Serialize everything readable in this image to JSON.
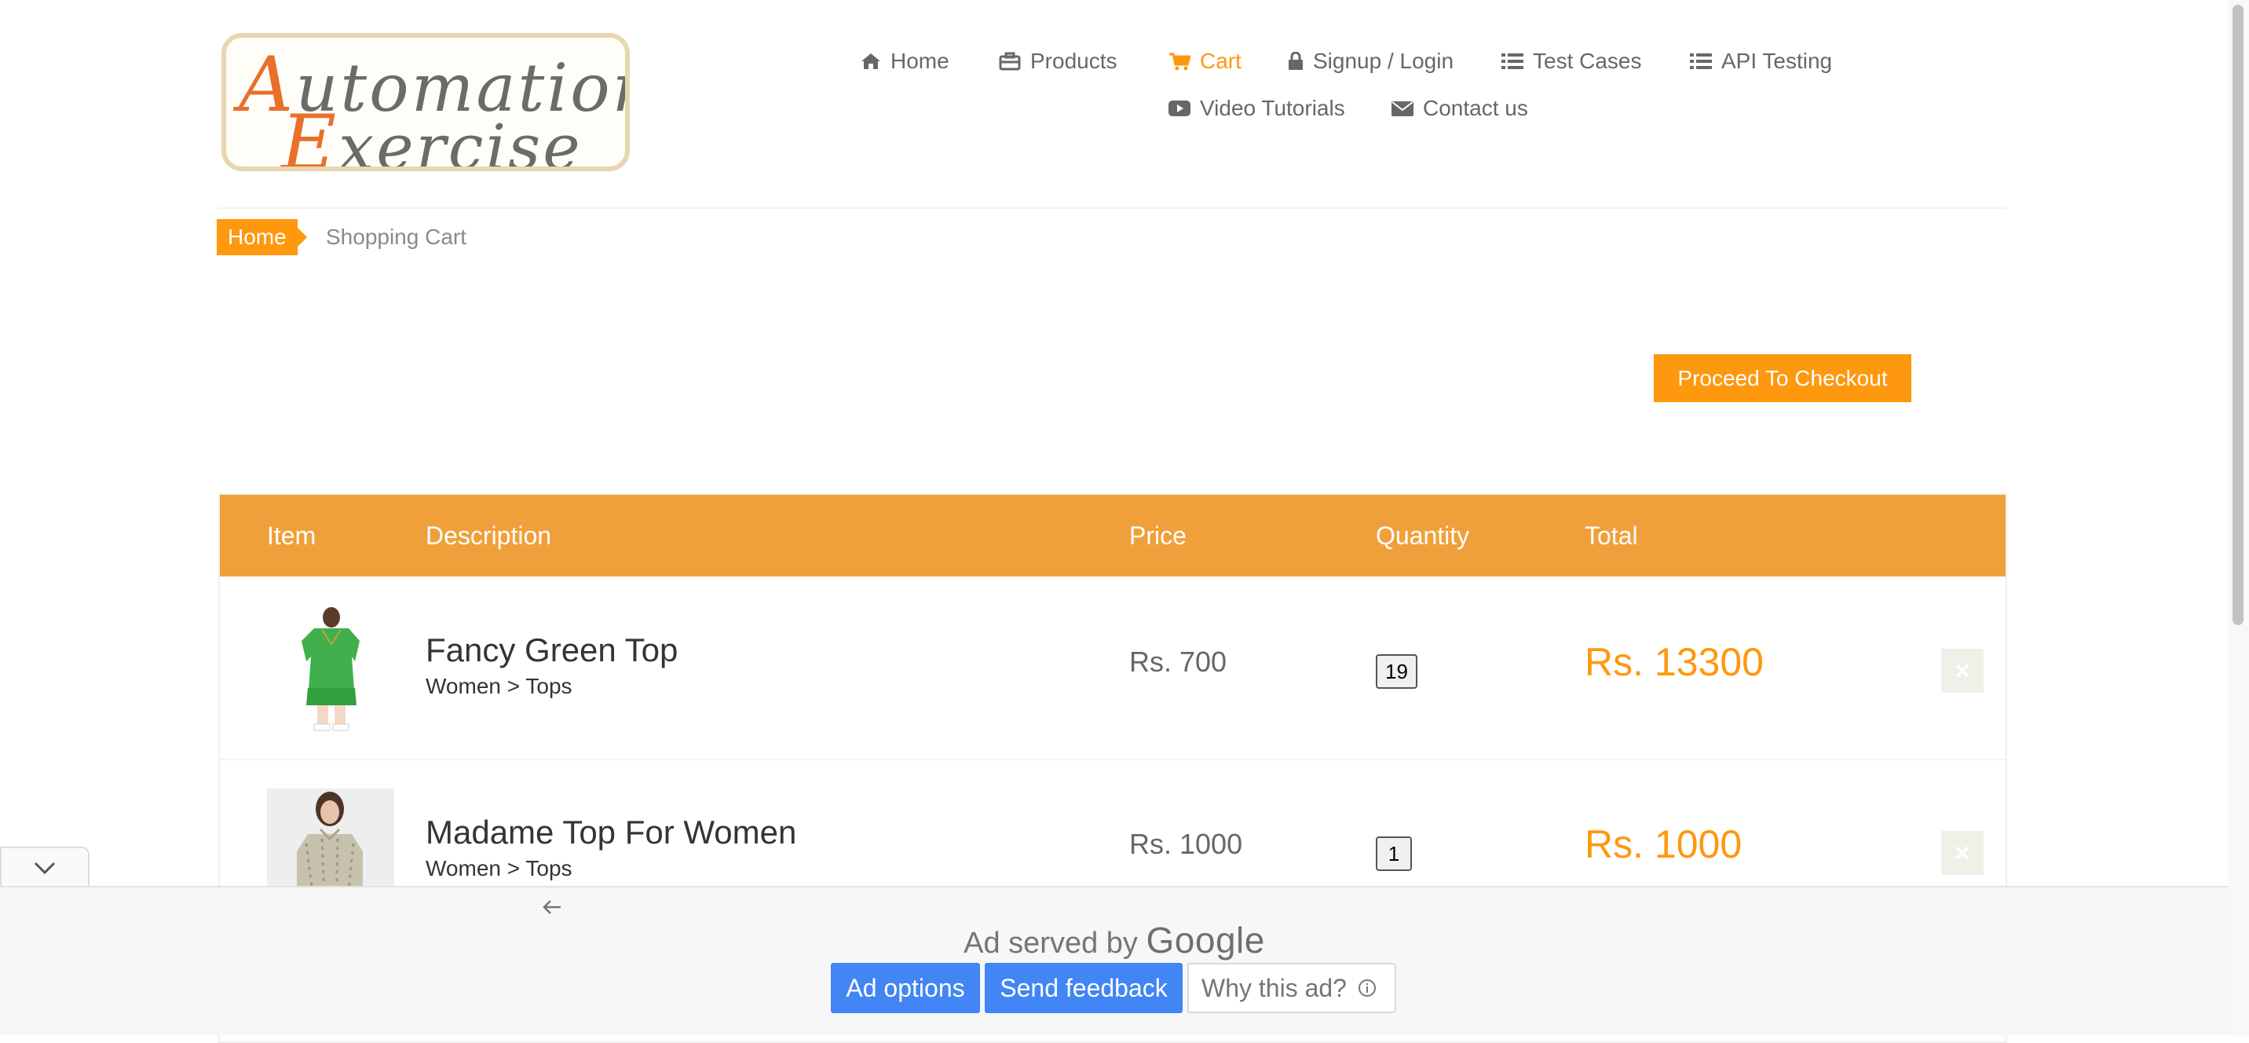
{
  "logo": {
    "line1_cap": "A",
    "line1_rest": "utomation",
    "line2_cap": "E",
    "line2_rest": "xercise"
  },
  "nav": {
    "items": [
      {
        "label": "Home",
        "icon": "home-icon"
      },
      {
        "label": "Products",
        "icon": "briefcase-icon"
      },
      {
        "label": "Cart",
        "icon": "shopping-cart-icon",
        "active": true
      },
      {
        "label": "Signup / Login",
        "icon": "lock-icon"
      },
      {
        "label": "Test Cases",
        "icon": "list-icon"
      },
      {
        "label": "API Testing",
        "icon": "list-icon"
      },
      {
        "label": "Video Tutorials",
        "icon": "youtube-play-icon"
      },
      {
        "label": "Contact us",
        "icon": "envelope-icon"
      }
    ]
  },
  "breadcrumb": {
    "home": "Home",
    "current": "Shopping Cart"
  },
  "checkout_button": "Proceed To Checkout",
  "cart": {
    "headers": [
      "Item",
      "Description",
      "Price",
      "Quantity",
      "Total"
    ],
    "rows": [
      {
        "name": "Fancy Green Top",
        "category": "Women > Tops",
        "price": "Rs. 700",
        "quantity": "19",
        "total": "Rs. 13300"
      },
      {
        "name": "Madame Top For Women",
        "category": "Women > Tops",
        "price": "Rs. 1000",
        "quantity": "1",
        "total": "Rs. 1000"
      }
    ]
  },
  "ad": {
    "served_by": "Ad served by",
    "brand": "Google",
    "options_button": "Ad options",
    "feedback_button": "Send feedback",
    "why_button": "Why this ad?"
  },
  "colors": {
    "accent": "#fe980f",
    "ad_blue": "#4285f4",
    "table_header": "#f0a03a"
  }
}
